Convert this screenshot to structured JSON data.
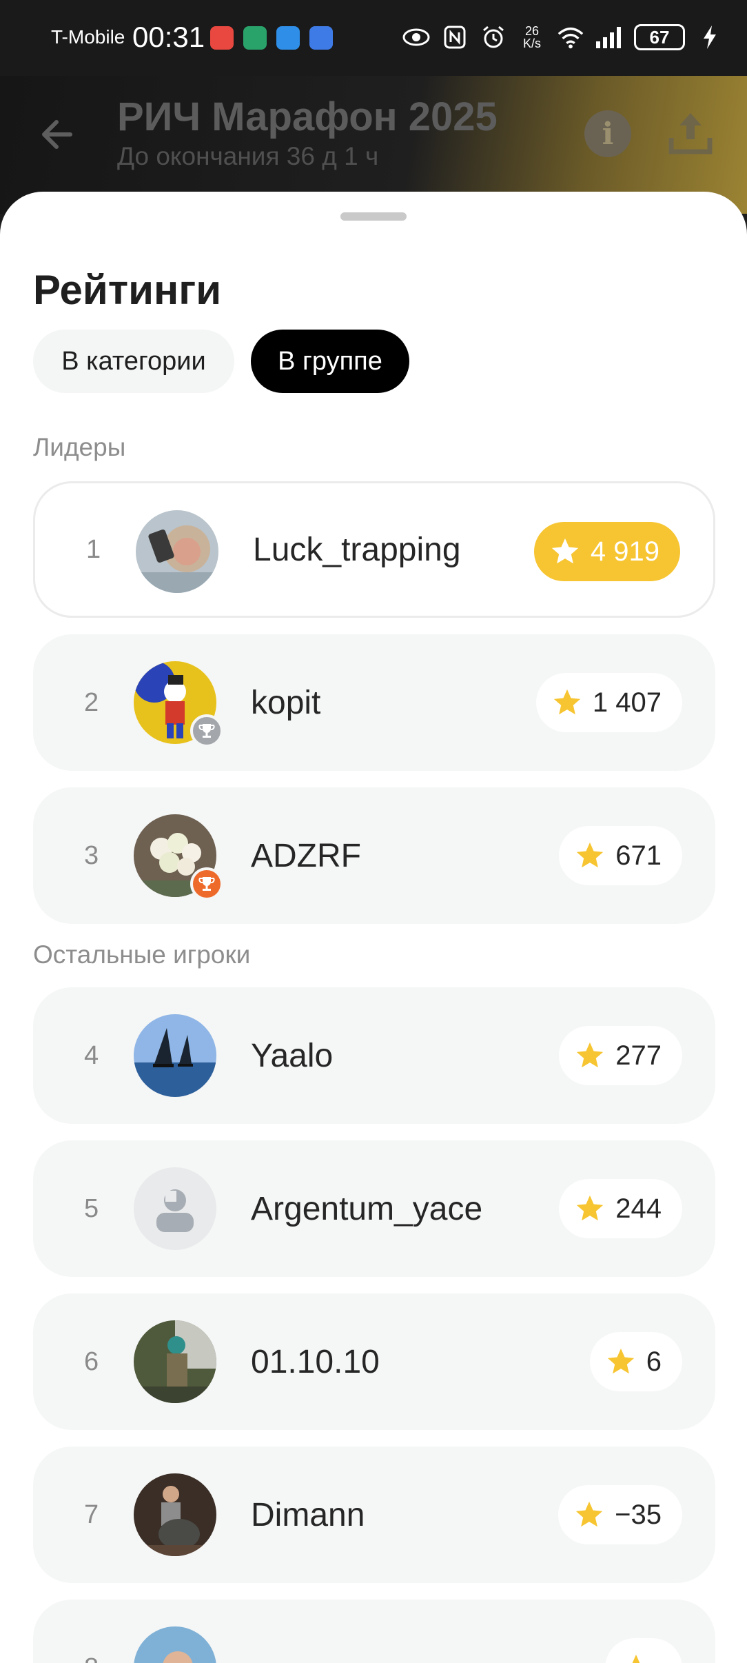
{
  "status_bar": {
    "carrier": "T-Mobile",
    "time": "00:31",
    "speed_value": "26",
    "speed_unit": "K/s",
    "battery": "67"
  },
  "header": {
    "title": "РИЧ Марафон 2025",
    "subtitle": "До окончания 36 д 1 ч",
    "info_glyph": "i"
  },
  "sheet": {
    "title": "Рейтинги",
    "tabs": [
      {
        "label": "В категории",
        "active": false
      },
      {
        "label": "В группе",
        "active": true
      }
    ],
    "sections": {
      "leaders": "Лидеры",
      "others": "Остальные игроки"
    }
  },
  "leaders": [
    {
      "rank": "1",
      "name": "Luck_trapping",
      "score": "4 919"
    },
    {
      "rank": "2",
      "name": "kopit",
      "score": "1 407"
    },
    {
      "rank": "3",
      "name": "ADZRF",
      "score": "671"
    }
  ],
  "players": [
    {
      "rank": "4",
      "name": "Yaalo",
      "score": "277"
    },
    {
      "rank": "5",
      "name": "Argentum_yace",
      "score": "244"
    },
    {
      "rank": "6",
      "name": "01.10.10",
      "score": "6"
    },
    {
      "rank": "7",
      "name": "Dimann",
      "score": "−35"
    },
    {
      "rank": "8",
      "name": "",
      "score": ""
    }
  ],
  "colors": {
    "gold": "#f7c531",
    "silver_badge": "#a3a7ab",
    "bronze_badge": "#ee6a2a",
    "active_tab": "#000000"
  },
  "icons": [
    "back-arrow-icon",
    "info-icon",
    "share-icon",
    "star-icon",
    "trophy-icon",
    "default-avatar-icon"
  ]
}
